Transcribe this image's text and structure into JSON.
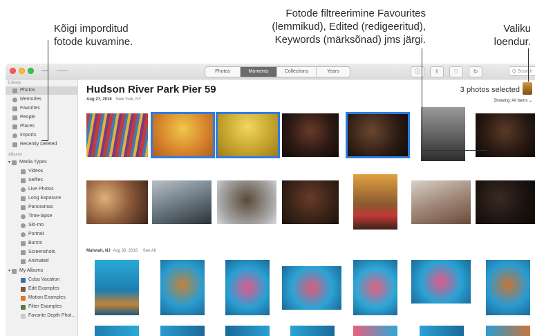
{
  "callouts": {
    "imports": [
      "Kõigi imporditud",
      "fotode kuvamine."
    ],
    "filter": [
      "Fotode filtreerimine Favourites",
      "(lemmikud), Edited (redigeeritud),",
      "Keywords (märksõnad) jms järgi."
    ],
    "count": [
      "Valiku",
      "loendur."
    ]
  },
  "toolbar": {
    "tabs": [
      "Photos",
      "Moments",
      "Collections",
      "Years"
    ],
    "active_tab": "Moments",
    "search_placeholder": "Q Search"
  },
  "sidebar": {
    "library_heading": "Library",
    "library_items": [
      "Photos",
      "Memories",
      "Favorites",
      "People",
      "Places",
      "Imports",
      "Recently Deleted"
    ],
    "albums_heading": "Albums",
    "media_types_label": "Media Types",
    "media_types": [
      "Videos",
      "Selfies",
      "Live Photos",
      "Long Exposure",
      "Panoramas",
      "Time-lapse",
      "Slo-mo",
      "Portrait",
      "Bursts",
      "Screenshots",
      "Animated"
    ],
    "my_albums_label": "My Albums",
    "my_albums": [
      "Cuba Vacation",
      "Edit Examples",
      "Motion Examples",
      "Filter Examples",
      "Favorite Depth Phot..."
    ]
  },
  "moment1": {
    "title": "Hudson River Park Pier 59",
    "date": "Aug 27, 2016",
    "location": "New York, NY",
    "selected_count": "3 photos selected",
    "showing": "Showing: All Items"
  },
  "moment2": {
    "location": "Mahwah, NJ",
    "date": "Aug 30, 2016",
    "see_all": "See All"
  },
  "colors": {
    "accent": "#2f7de1",
    "sidebar_bg": "#f1f1f2"
  }
}
